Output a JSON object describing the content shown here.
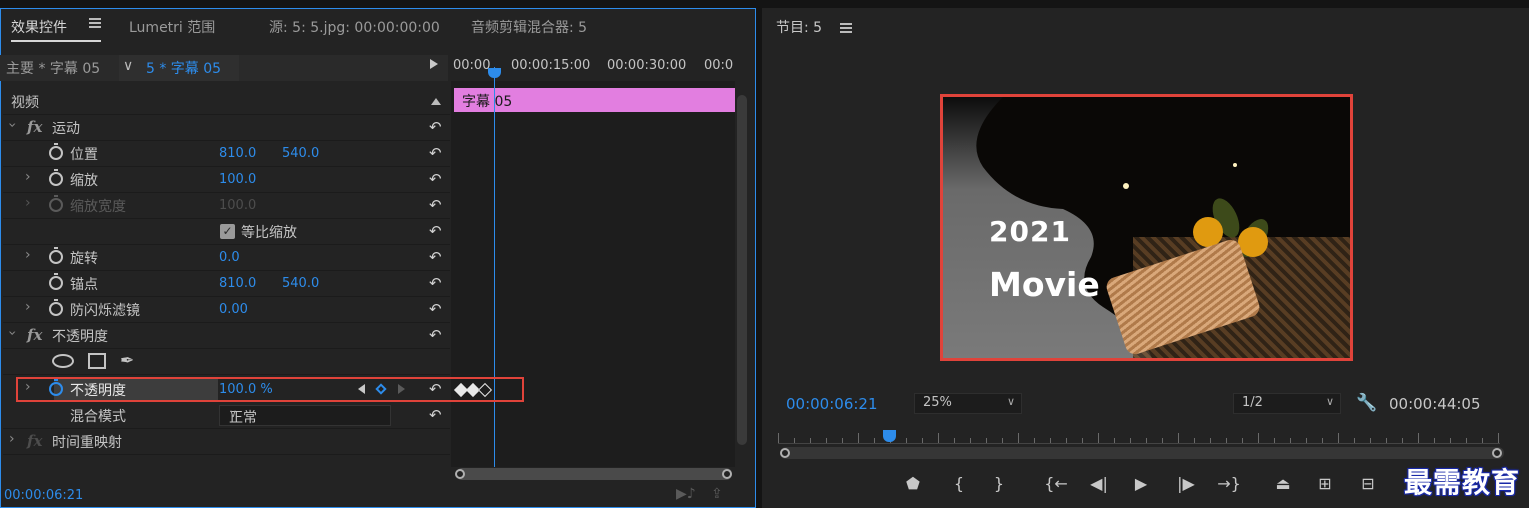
{
  "effect_controls": {
    "tabs": [
      {
        "label": "效果控件"
      },
      {
        "label": "Lumetri 范围"
      },
      {
        "label": "源: 5: 5.jpg: 00:00:00:00"
      },
      {
        "label": "音频剪辑混合器: 5"
      }
    ],
    "clip_header": {
      "master": "主要 * 字幕 05",
      "clip": "5 * 字幕 05",
      "chevron": "∨"
    },
    "ruler_labels": [
      "00:00",
      "00:00:15:00",
      "00:00:30:00",
      "00:0"
    ],
    "clip_bar_label": "字幕 05",
    "section_video": "视频",
    "motion": {
      "label": "运动",
      "position": {
        "label": "位置",
        "x": "810.0",
        "y": "540.0"
      },
      "scale": {
        "label": "缩放",
        "value": "100.0"
      },
      "scale_width": {
        "label": "缩放宽度",
        "value": "100.0"
      },
      "uniform_scale": {
        "label": "等比缩放",
        "checked": true
      },
      "rotation": {
        "label": "旋转",
        "value": "0.0"
      },
      "anchor": {
        "label": "锚点",
        "x": "810.0",
        "y": "540.0"
      },
      "anti_flicker": {
        "label": "防闪烁滤镜",
        "value": "0.00"
      }
    },
    "opacity": {
      "label": "不透明度",
      "opacity_value": {
        "label": "不透明度",
        "value": "100.0 %"
      },
      "blend_mode": {
        "label": "混合模式",
        "value": "正常"
      },
      "keyframes": 3
    },
    "time_remap": {
      "label": "时间重映射"
    },
    "footer_time": "00:00:06:21",
    "icons": {
      "fx": "fx",
      "expand": "›",
      "reset": "↶",
      "pen": "✒",
      "check": "✓"
    }
  },
  "program_monitor": {
    "title": "节目: 5",
    "frame_text": {
      "year": "2021",
      "word": "Movie"
    },
    "current_time": "00:00:06:21",
    "zoom": "25%",
    "resolution": "1/2",
    "duration": "00:00:44:05",
    "transport": [
      {
        "name": "add-marker-button",
        "glyph": "⬟"
      },
      {
        "name": "mark-in-button",
        "glyph": "{"
      },
      {
        "name": "mark-out-button",
        "glyph": "}"
      },
      {
        "name": "go-to-in-button",
        "glyph": "{←"
      },
      {
        "name": "step-back-button",
        "glyph": "◀|"
      },
      {
        "name": "play-button",
        "glyph": "▶"
      },
      {
        "name": "step-forward-button",
        "glyph": "|▶"
      },
      {
        "name": "go-to-out-button",
        "glyph": "→}"
      },
      {
        "name": "lift-button",
        "glyph": "⏏"
      },
      {
        "name": "extract-button",
        "glyph": "⊞"
      },
      {
        "name": "export-frame-button",
        "glyph": "⊟"
      }
    ]
  },
  "watermark": "最需教育",
  "colors": {
    "accent": "#2d8ceb",
    "highlight": "#e0433a",
    "clip": "#e27ee0",
    "panel": "#232323"
  }
}
